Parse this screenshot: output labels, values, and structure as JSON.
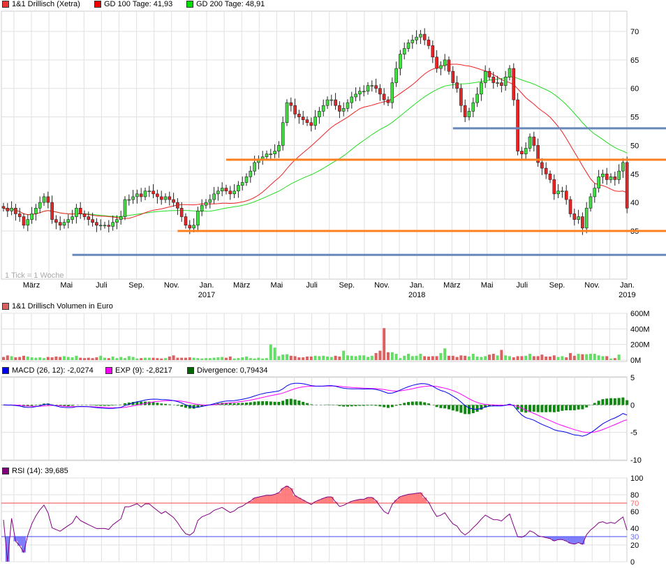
{
  "legend": {
    "price": {
      "label": "1&1 Drillisch (Xetra)",
      "color": "#ee3333"
    },
    "gd100": {
      "label": "GD 100 Tage: 41,93",
      "color": "#ee0000"
    },
    "gd200": {
      "label": "GD 200 Tage: 48,91",
      "color": "#00dd00"
    },
    "volume": {
      "label": "1&1 Drillisch Volumen in Euro",
      "color": "#d86060"
    },
    "macd": {
      "label": "MACD (26, 12): -2,0274",
      "color": "#0000ee"
    },
    "exp": {
      "label": "EXP (9): -2,8217",
      "color": "#ff00ff"
    },
    "divergence": {
      "label": "Divergence: 0,79434",
      "color": "#006600"
    },
    "rsi": {
      "label": "RSI (14): 39,685",
      "color": "#800080"
    }
  },
  "tick_note": "1 Tick = 1 Woche",
  "chart_data": {
    "type": "candlestick",
    "interval": "weekly",
    "x_month_labels": [
      "März",
      "Mai",
      "Juli",
      "Sep.",
      "Nov.",
      "Jan.",
      "März",
      "Mai",
      "Juli",
      "Sep.",
      "Nov.",
      "Jan.",
      "März",
      "Mai",
      "Juli",
      "Sep.",
      "Nov.",
      "Jan."
    ],
    "x_year_labels": [
      "2017",
      "2018",
      "2019"
    ],
    "price_axis": {
      "ticks": [
        "35",
        "40",
        "45",
        "50",
        "55",
        "60",
        "65",
        "70"
      ],
      "ylim": [
        30,
        73
      ]
    },
    "close": [
      39,
      38.5,
      39,
      38,
      37.5,
      36,
      37,
      38,
      39,
      40,
      41,
      40,
      37,
      36.5,
      36,
      36.5,
      37,
      37.5,
      39,
      38,
      37.5,
      37,
      36.5,
      36,
      36,
      36,
      35.8,
      36.5,
      37,
      37.5,
      40.5,
      40.5,
      41,
      41.5,
      41,
      42,
      42,
      41.5,
      41,
      40.5,
      41,
      40.5,
      40,
      39,
      37.5,
      36,
      35.5,
      36,
      38.5,
      39.5,
      40,
      40.5,
      41.5,
      42,
      42.5,
      42,
      41.5,
      42,
      43,
      43.5,
      44.5,
      45.5,
      47,
      47.5,
      48,
      48.5,
      48.5,
      49,
      50,
      54,
      57.5,
      57,
      55.5,
      55,
      54.5,
      54,
      53.5,
      55,
      56,
      57,
      58,
      58,
      57,
      56,
      56.5,
      57.5,
      58.5,
      59,
      59.5,
      59.5,
      60.5,
      60.5,
      60,
      59,
      58,
      57.5,
      61,
      63.5,
      66,
      67,
      68,
      68.5,
      69,
      69.5,
      68.5,
      67.5,
      65.5,
      63.5,
      64,
      65,
      63,
      61,
      60,
      57,
      55,
      56,
      57.5,
      59,
      61,
      63,
      62,
      61,
      61,
      60.5,
      62,
      63.5,
      58,
      49,
      48.5,
      49.5,
      51.5,
      50,
      47,
      46,
      45,
      44,
      41.5,
      42,
      42,
      40.5,
      38,
      37,
      37.5,
      35.5,
      39,
      41,
      42.5,
      44.5,
      45,
      44,
      44.5,
      44,
      45.5,
      47,
      39
    ],
    "volume_m": [
      40,
      60,
      50,
      35,
      40,
      55,
      45,
      35,
      30,
      35,
      25,
      40,
      35,
      45,
      40,
      50,
      40,
      35,
      55,
      30,
      25,
      30,
      25,
      35,
      55,
      30,
      25,
      45,
      25,
      40,
      25,
      50,
      40,
      20,
      25,
      30,
      30,
      30,
      25,
      20,
      25,
      45,
      60,
      30,
      30,
      30,
      35,
      30,
      25,
      20,
      25,
      25,
      30,
      35,
      40,
      30,
      45,
      20,
      25,
      35,
      45,
      25,
      20,
      30,
      20,
      25,
      200,
      160,
      50,
      70,
      75,
      55,
      50,
      35,
      35,
      45,
      45,
      55,
      50,
      55,
      45,
      40,
      55,
      45,
      120,
      60,
      55,
      50,
      60,
      60,
      40,
      55,
      90,
      120,
      410,
      100,
      100,
      80,
      25,
      55,
      80,
      50,
      55,
      80,
      50,
      45,
      50,
      50,
      90,
      150,
      55,
      55,
      40,
      60,
      55,
      45,
      80,
      45,
      40,
      50,
      70,
      80,
      60,
      130,
      60,
      50,
      35,
      50,
      50,
      55,
      80,
      50,
      50,
      70,
      45,
      45,
      60,
      40,
      50,
      35,
      90,
      55,
      80,
      75,
      75,
      80,
      80,
      60,
      50,
      50,
      20,
      25,
      70
    ],
    "volume_axis": {
      "ticks": [
        "0M",
        "200M",
        "400M",
        "600M"
      ],
      "ylim": [
        0,
        600
      ]
    },
    "macd_axis": {
      "ticks": [
        "5",
        "0",
        "-5",
        "-10"
      ],
      "ylim": [
        -10,
        5
      ]
    },
    "rsi_axis": {
      "ticks": [
        "0",
        "20",
        "30",
        "40",
        "60",
        "70",
        "80",
        "100"
      ],
      "ylim": [
        0,
        100
      ],
      "overbought": 70,
      "oversold": 30
    },
    "support_resistance": [
      {
        "level": 47.5,
        "color": "#ff7f1e",
        "from_week": 55
      },
      {
        "level": 35,
        "color": "#ff7f1e",
        "from_week": 43
      },
      {
        "level": 53,
        "color": "#6688bb",
        "from_week": 111
      },
      {
        "level": 30.8,
        "color": "#6688bb",
        "from_week": 17
      }
    ]
  }
}
